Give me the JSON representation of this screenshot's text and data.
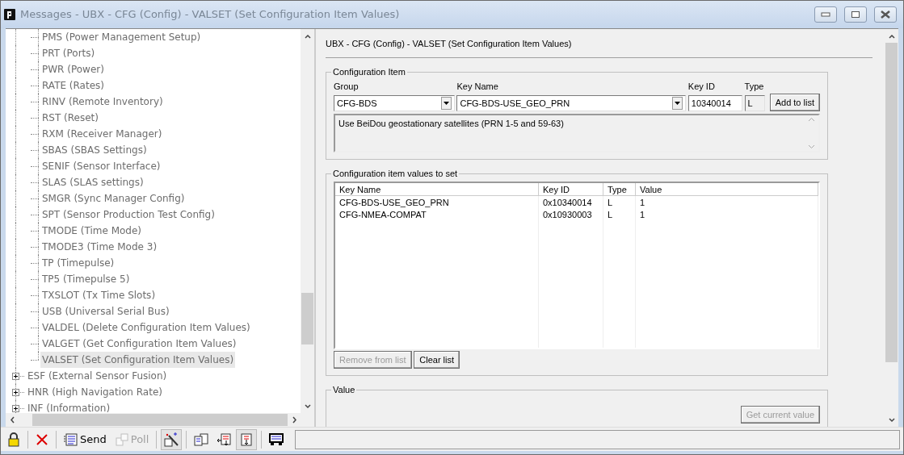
{
  "window": {
    "title": "Messages - UBX - CFG (Config) - VALSET (Set Configuration Item Values)"
  },
  "tree": {
    "children": [
      {
        "label": "PMS (Power Management Setup)",
        "selected": false
      },
      {
        "label": "PRT (Ports)",
        "selected": false
      },
      {
        "label": "PWR (Power)",
        "selected": false
      },
      {
        "label": "RATE (Rates)",
        "selected": false
      },
      {
        "label": "RINV (Remote Inventory)",
        "selected": false
      },
      {
        "label": "RST (Reset)",
        "selected": false
      },
      {
        "label": "RXM (Receiver Manager)",
        "selected": false
      },
      {
        "label": "SBAS (SBAS Settings)",
        "selected": false
      },
      {
        "label": "SENIF (Sensor Interface)",
        "selected": false
      },
      {
        "label": "SLAS (SLAS settings)",
        "selected": false
      },
      {
        "label": "SMGR (Sync Manager Config)",
        "selected": false
      },
      {
        "label": "SPT (Sensor Production Test Config)",
        "selected": false
      },
      {
        "label": "TMODE (Time Mode)",
        "selected": false
      },
      {
        "label": "TMODE3 (Time Mode 3)",
        "selected": false
      },
      {
        "label": "TP (Timepulse)",
        "selected": false
      },
      {
        "label": "TP5 (Timepulse 5)",
        "selected": false
      },
      {
        "label": "TXSLOT (Tx Time Slots)",
        "selected": false
      },
      {
        "label": "USB (Universal Serial Bus)",
        "selected": false
      },
      {
        "label": "VALDEL (Delete Configuration Item Values)",
        "selected": false
      },
      {
        "label": "VALGET (Get Configuration Item Values)",
        "selected": false
      },
      {
        "label": "VALSET (Set Configuration Item Values)",
        "selected": true
      }
    ],
    "siblings": [
      {
        "label": "ESF (External Sensor Fusion)",
        "expanded": false
      },
      {
        "label": "HNR (High Navigation Rate)",
        "expanded": false
      },
      {
        "label": "INF (Information)",
        "expanded": false
      }
    ]
  },
  "panel": {
    "heading": "UBX - CFG (Config) - VALSET (Set Configuration Item Values)",
    "config_item": {
      "legend": "Configuration Item",
      "group_label": "Group",
      "group": "CFG-BDS",
      "key_name_label": "Key Name",
      "key_name": "CFG-BDS-USE_GEO_PRN",
      "key_id_label": "Key ID",
      "key_id": "10340014",
      "type_label": "Type",
      "type": "L",
      "add_button": "Add to list",
      "description": "Use BeiDou geostationary satellites (PRN 1-5 and 59-63)"
    },
    "values_to_set": {
      "legend": "Configuration item values to set",
      "columns": [
        "Key Name",
        "Key ID",
        "Type",
        "Value"
      ],
      "rows": [
        [
          "CFG-BDS-USE_GEO_PRN",
          "0x10340014",
          "L",
          "1"
        ],
        [
          "CFG-NMEA-COMPAT",
          "0x10930003",
          "L",
          "1"
        ]
      ],
      "buttons": [
        {
          "label": "Remove from list",
          "disabled": true
        },
        {
          "label": "Clear list",
          "disabled": false
        }
      ]
    },
    "value": {
      "legend": "Value",
      "button": {
        "label": "Get current value",
        "disabled": true
      }
    }
  },
  "toolbar": [
    {
      "kind": "lock",
      "pressed": false,
      "disabled": false
    },
    {
      "kind": "delete",
      "pressed": false,
      "disabled": false
    },
    {
      "kind": "send",
      "label": "Send",
      "pressed": false,
      "disabled": false
    },
    {
      "kind": "poll",
      "label": "Poll",
      "pressed": false,
      "disabled": true
    },
    {
      "kind": "wizard",
      "pressed": true,
      "disabled": false
    },
    {
      "kind": "copy",
      "pressed": false,
      "disabled": false
    },
    {
      "kind": "import",
      "pressed": false,
      "disabled": false
    },
    {
      "kind": "export",
      "pressed": true,
      "disabled": false
    },
    {
      "kind": "print",
      "pressed": false,
      "disabled": false
    }
  ]
}
